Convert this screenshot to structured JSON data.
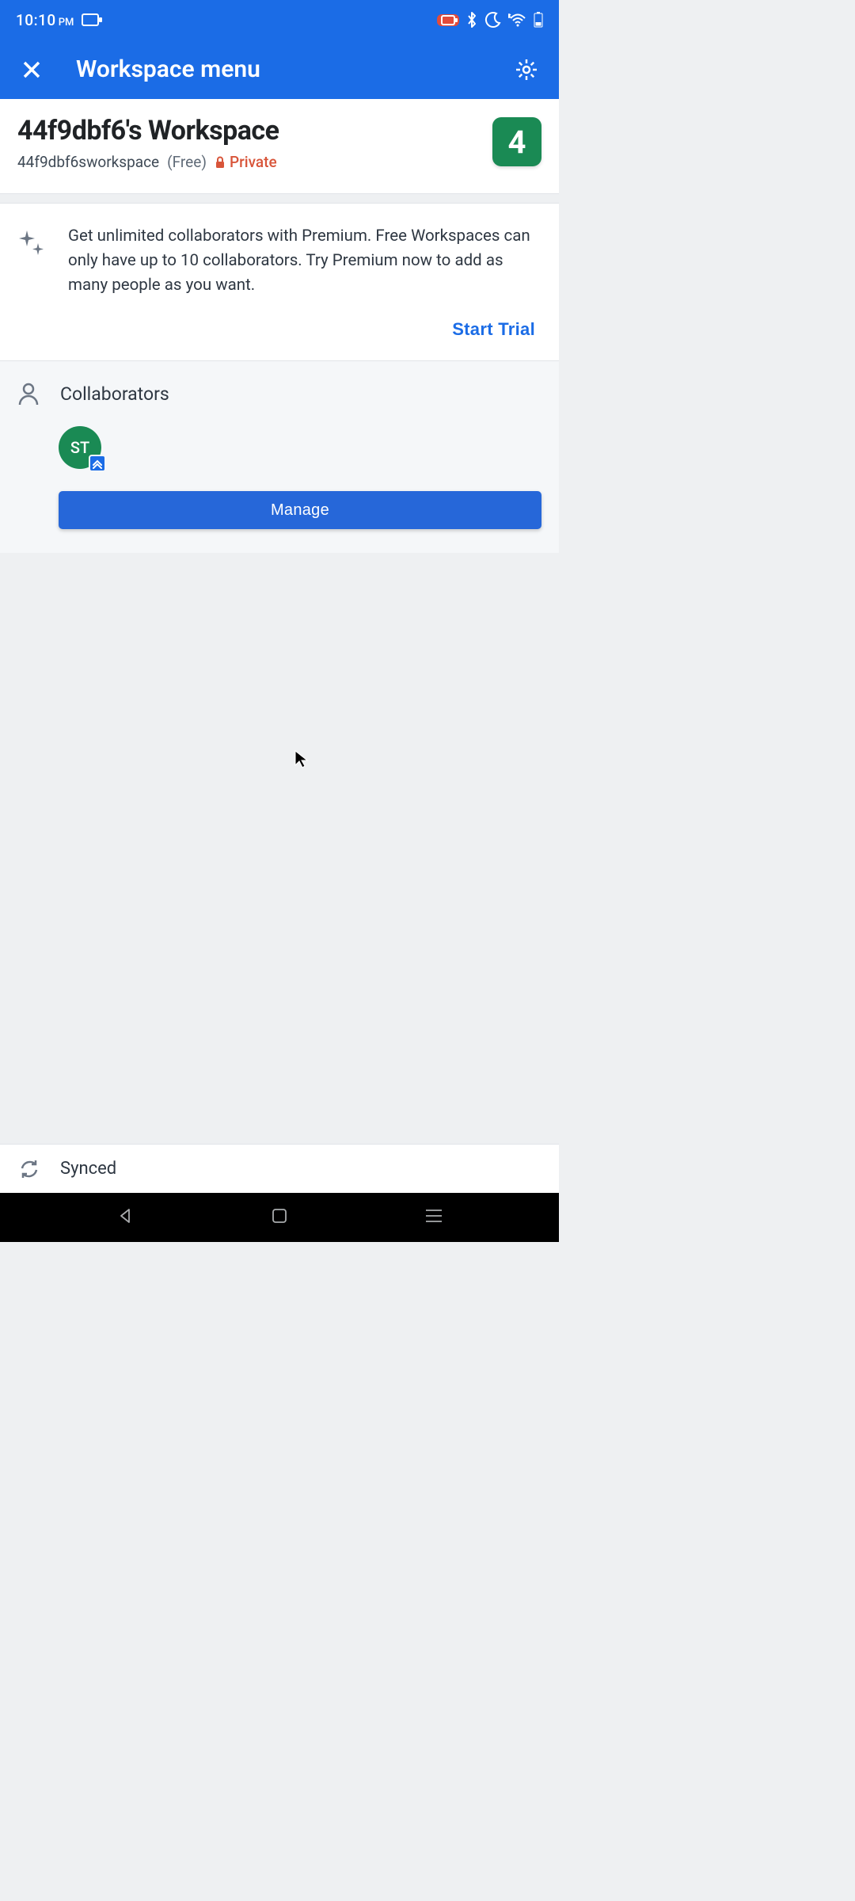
{
  "status": {
    "time": "10:10",
    "period": "PM"
  },
  "appbar": {
    "title": "Workspace menu"
  },
  "workspace": {
    "title": "44f9dbf6's Workspace",
    "slug": "44f9dbf6sworkspace",
    "plan": "(Free)",
    "privacy": "Private",
    "badge": "4"
  },
  "premium": {
    "text": "Get unlimited collaborators with Premium. Free Workspaces can only have up to 10 collaborators. Try Premium now to add as many people as you want.",
    "cta": "Start Trial"
  },
  "collaborators": {
    "title": "Collaborators",
    "avatars": [
      {
        "initials": "ST"
      }
    ],
    "manage_label": "Manage"
  },
  "sync": {
    "label": "Synced"
  }
}
